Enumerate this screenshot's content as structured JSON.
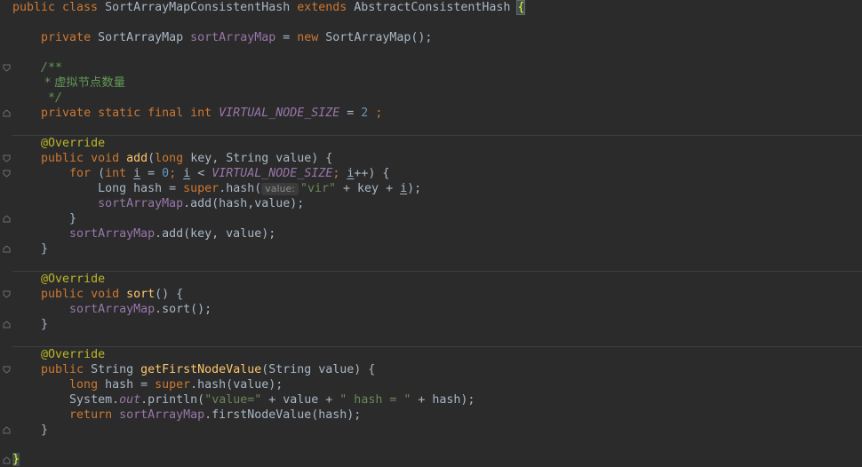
{
  "code": {
    "l1": {
      "kw1": "public class ",
      "name": "SortArrayMapConsistentHash ",
      "kw2": "extends ",
      "parent": "AbstractConsistentHash ",
      "brace": "{"
    },
    "l3": {
      "kw": "private ",
      "type": "SortArrayMap ",
      "field": "sortArrayMap",
      "eq": " = ",
      "kwnew": "new ",
      "ctor": "SortArrayMap();"
    },
    "l5": {
      "cmt": "/**"
    },
    "l6": {
      "cmt": " * 虚拟节点数量"
    },
    "l7": {
      "cmt": " */"
    },
    "l8": {
      "kw": "private static final int ",
      "const": "VIRTUAL_NODE_SIZE",
      "eq": " = ",
      "num": "2",
      "end": " ;"
    },
    "l10": {
      "ann": "@Override"
    },
    "l11": {
      "kw": "public void ",
      "fn": "add",
      "rest1": "(",
      "kwlong": "long ",
      "rest2": "key, String value) {"
    },
    "l12": {
      "kwfor": "for ",
      "p1": "(",
      "kwint": "int ",
      "var1": "i",
      "p2": " = ",
      "num": "0",
      "p3": "; ",
      "var2": "i",
      "p4": " < ",
      "const": "VIRTUAL_NODE_SIZE",
      "p5": "; ",
      "var3": "i",
      "p6": "++) {"
    },
    "l13": {
      "p1": "Long hash = ",
      "kwsuper": "super",
      "p2": ".hash(",
      "hint": "value:",
      "str": "\"vir\"",
      "p3": " + key + ",
      "var": "i",
      "p4": ");"
    },
    "l14": {
      "field": "sortArrayMap",
      "rest": ".add(hash,value);"
    },
    "l15": {
      "text": "}"
    },
    "l16": {
      "field": "sortArrayMap",
      "rest": ".add(key, value);"
    },
    "l17": {
      "text": "}"
    },
    "l19": {
      "ann": "@Override"
    },
    "l20": {
      "kw": "public void ",
      "fn": "sort",
      "rest": "() {"
    },
    "l21": {
      "field": "sortArrayMap",
      "rest": ".sort();"
    },
    "l22": {
      "text": "}"
    },
    "l24": {
      "ann": "@Override"
    },
    "l25": {
      "kw": "public ",
      "type": "String ",
      "fn": "getFirstNodeValue",
      "rest": "(String value) {"
    },
    "l26": {
      "kw": "long ",
      "p1": "hash = ",
      "kwsuper": "super",
      "p2": ".hash(value);"
    },
    "l27": {
      "p1": "System.",
      "out": "out",
      "p2": ".println(",
      "str1": "\"value=\"",
      "p3": " + value + ",
      "str2": "\" hash = \"",
      "p4": " + hash);"
    },
    "l28": {
      "kw": "return ",
      "field": "sortArrayMap",
      "rest": ".firstNodeValue(hash);"
    },
    "l29": {
      "text": "}"
    },
    "l31": {
      "brace": "}"
    }
  }
}
